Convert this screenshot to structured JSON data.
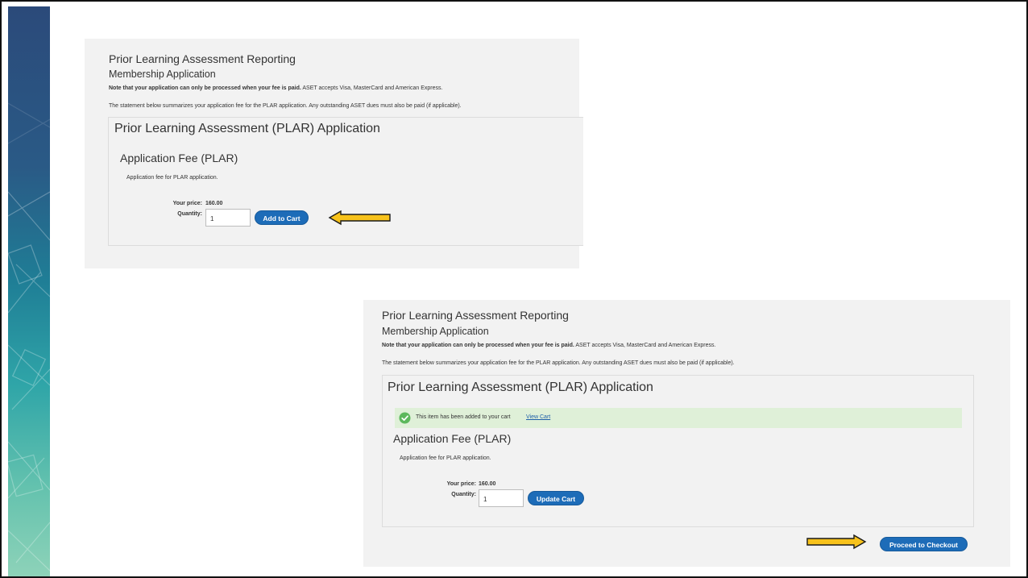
{
  "colors": {
    "button_blue": "#1d6cb8",
    "arrow_fill": "#f7c21b",
    "success_bg": "#dff0d8",
    "success_icon": "#5cb85c",
    "link": "#1f5fa8",
    "panel_bg": "#f2f2f2"
  },
  "icons": {
    "success": "check-circle-icon",
    "pointer": "arrow-icon"
  },
  "screen1": {
    "site_title": "Prior Learning Assessment Reporting",
    "subtitle": "Membership Application",
    "note_bold": "Note that your application can only be processed when your fee is paid.",
    "note_rest": " ASET accepts Visa, MasterCard and American Express.",
    "statement": "The statement below summarizes your application fee for the PLAR application. Any outstanding ASET dues must also be paid (if applicable).",
    "panel_title": "Prior Learning Assessment (PLAR) Application",
    "product_name": "Application Fee (PLAR)",
    "product_desc": "Application fee for PLAR application.",
    "price_label": "Your price:",
    "price_value": "160.00",
    "qty_label": "Quantity:",
    "qty_value": "1",
    "add_button": "Add to Cart"
  },
  "screen2": {
    "site_title": "Prior Learning Assessment Reporting",
    "subtitle": "Membership Application",
    "note_bold": "Note that your application can only be processed when your fee is paid.",
    "note_rest": " ASET accepts Visa, MasterCard and American Express.",
    "statement": "The statement below summarizes your application fee for the PLAR application. Any outstanding ASET dues must also be paid (if applicable).",
    "panel_title": "Prior Learning Assessment (PLAR) Application",
    "success_message": "This item has been added to your cart",
    "view_cart_link": "View Cart",
    "product_name": "Application Fee (PLAR)",
    "product_desc": "Application fee for PLAR application.",
    "price_label": "Your price:",
    "price_value": "160.00",
    "qty_label": "Quantity:",
    "qty_value": "1",
    "update_button": "Update Cart",
    "checkout_button": "Proceed to Checkout"
  }
}
